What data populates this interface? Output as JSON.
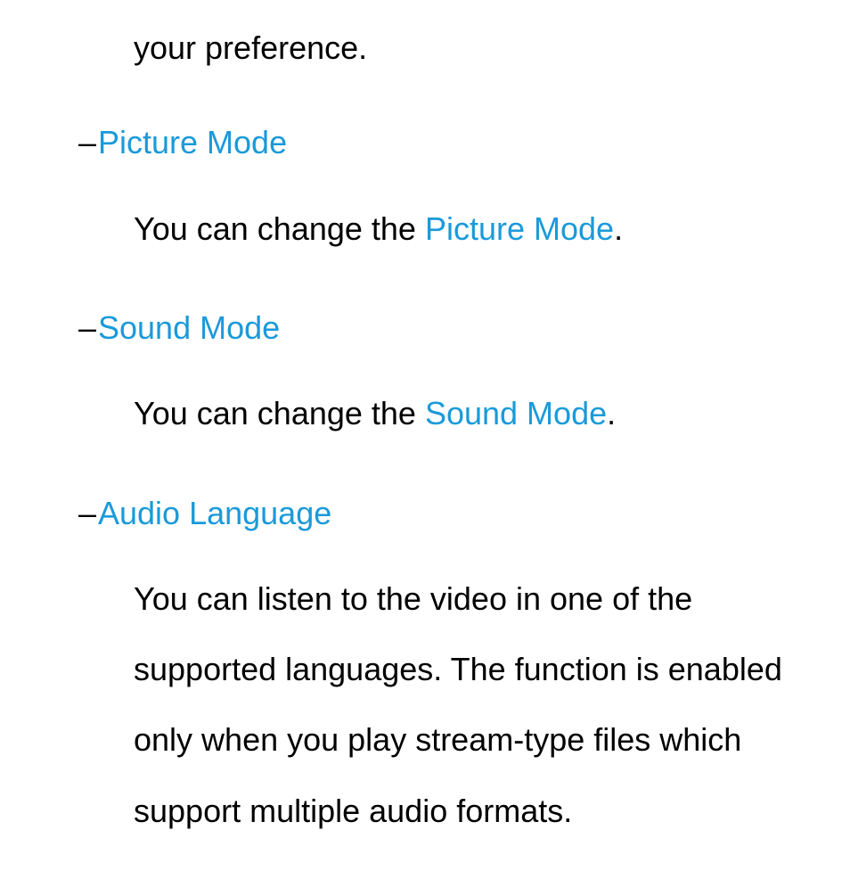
{
  "fragment": "your preference.",
  "items": [
    {
      "dash": "–",
      "heading": "Picture Mode",
      "desc_pre": "You can change the ",
      "desc_link": "Picture Mode",
      "desc_post": "."
    },
    {
      "dash": "–",
      "heading": "Sound Mode",
      "desc_pre": "You can change the ",
      "desc_link": "Sound Mode",
      "desc_post": "."
    },
    {
      "dash": "–",
      "heading": "Audio Language",
      "desc_pre": "You can listen to the video in one of the supported languages. The function is enabled only when you play stream-type files which support multiple audio formats.",
      "desc_link": "",
      "desc_post": ""
    }
  ]
}
